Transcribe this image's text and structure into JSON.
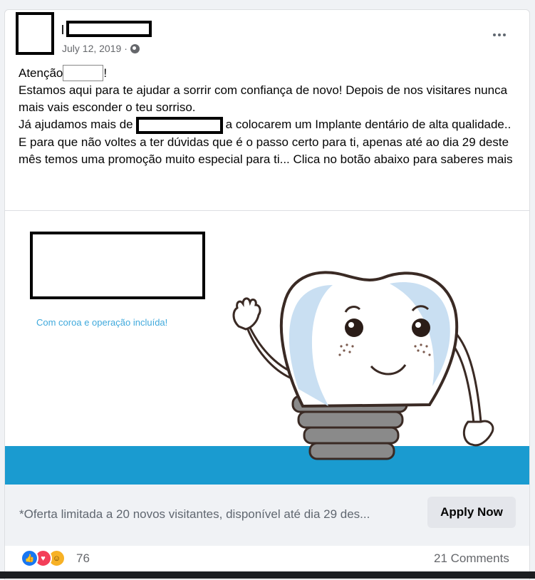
{
  "post": {
    "date": "July 12, 2019",
    "separator": "·",
    "privacy_icon": "globe-icon",
    "more_icon": "more-options-icon",
    "text": {
      "line1_prefix": "Atenção",
      "line1_suffix": "!",
      "line2": "Estamos aqui para te ajudar a sorrir com confiança de novo! Depois de nos visitares nunca mais vais esconder o teu sorriso.",
      "line3_prefix": "Já ajudamos mais de",
      "line3_suffix": "a colocarem um Implante dentário de alta qualidade..",
      "line4": "E para que não voltes a ter dúvidas que é o passo certo para ti, apenas até ao dia 29 deste mês temos uma promoção muito especial para ti... Clica no botão abaixo para saberes mais"
    }
  },
  "ad": {
    "caption": "Com coroa e operação incluída!",
    "stripe_color": "#1a9bd0",
    "caption_color": "#3fa9dc"
  },
  "cta": {
    "description": "*Oferta limitada a 20 novos visitantes, disponível até dia 29 des...",
    "button_label": "Apply Now"
  },
  "engagement": {
    "reaction_icons": [
      "like-icon",
      "love-icon",
      "haha-icon"
    ],
    "reaction_count": "76",
    "comments": "21 Comments"
  }
}
